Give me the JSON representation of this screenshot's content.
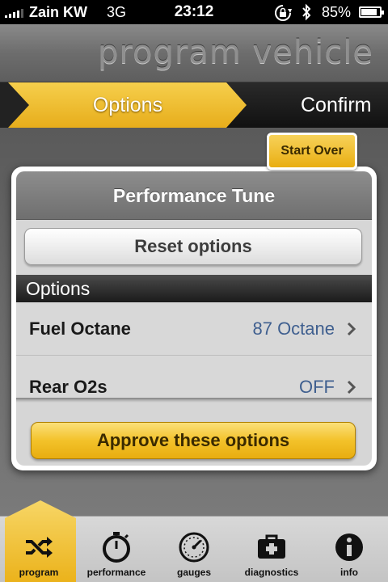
{
  "status_bar": {
    "carrier": "Zain KW",
    "network": "3G",
    "time": "23:12",
    "battery_percent": "85%",
    "battery_level": 0.85
  },
  "header": {
    "title": "program vehicle"
  },
  "steps": {
    "active": "Options",
    "next": "Confirm"
  },
  "start_over_label": "Start Over",
  "modal": {
    "title": "Performance Tune",
    "reset_label": "Reset options",
    "section_header": "Options",
    "rows": [
      {
        "label": "Fuel Octane",
        "value": "87 Octane"
      },
      {
        "label": "Rear O2s",
        "value": "OFF"
      }
    ],
    "approve_label": "Approve these options"
  },
  "tabs": [
    {
      "label": "program",
      "icon": "shuffle-icon",
      "active": true
    },
    {
      "label": "performance",
      "icon": "stopwatch-icon",
      "active": false
    },
    {
      "label": "gauges",
      "icon": "gauge-icon",
      "active": false
    },
    {
      "label": "diagnostics",
      "icon": "medkit-icon",
      "active": false
    },
    {
      "label": "info",
      "icon": "info-icon",
      "active": false
    }
  ],
  "colors": {
    "accent_yellow": "#f3c22a",
    "value_blue": "#3f5f8f"
  }
}
